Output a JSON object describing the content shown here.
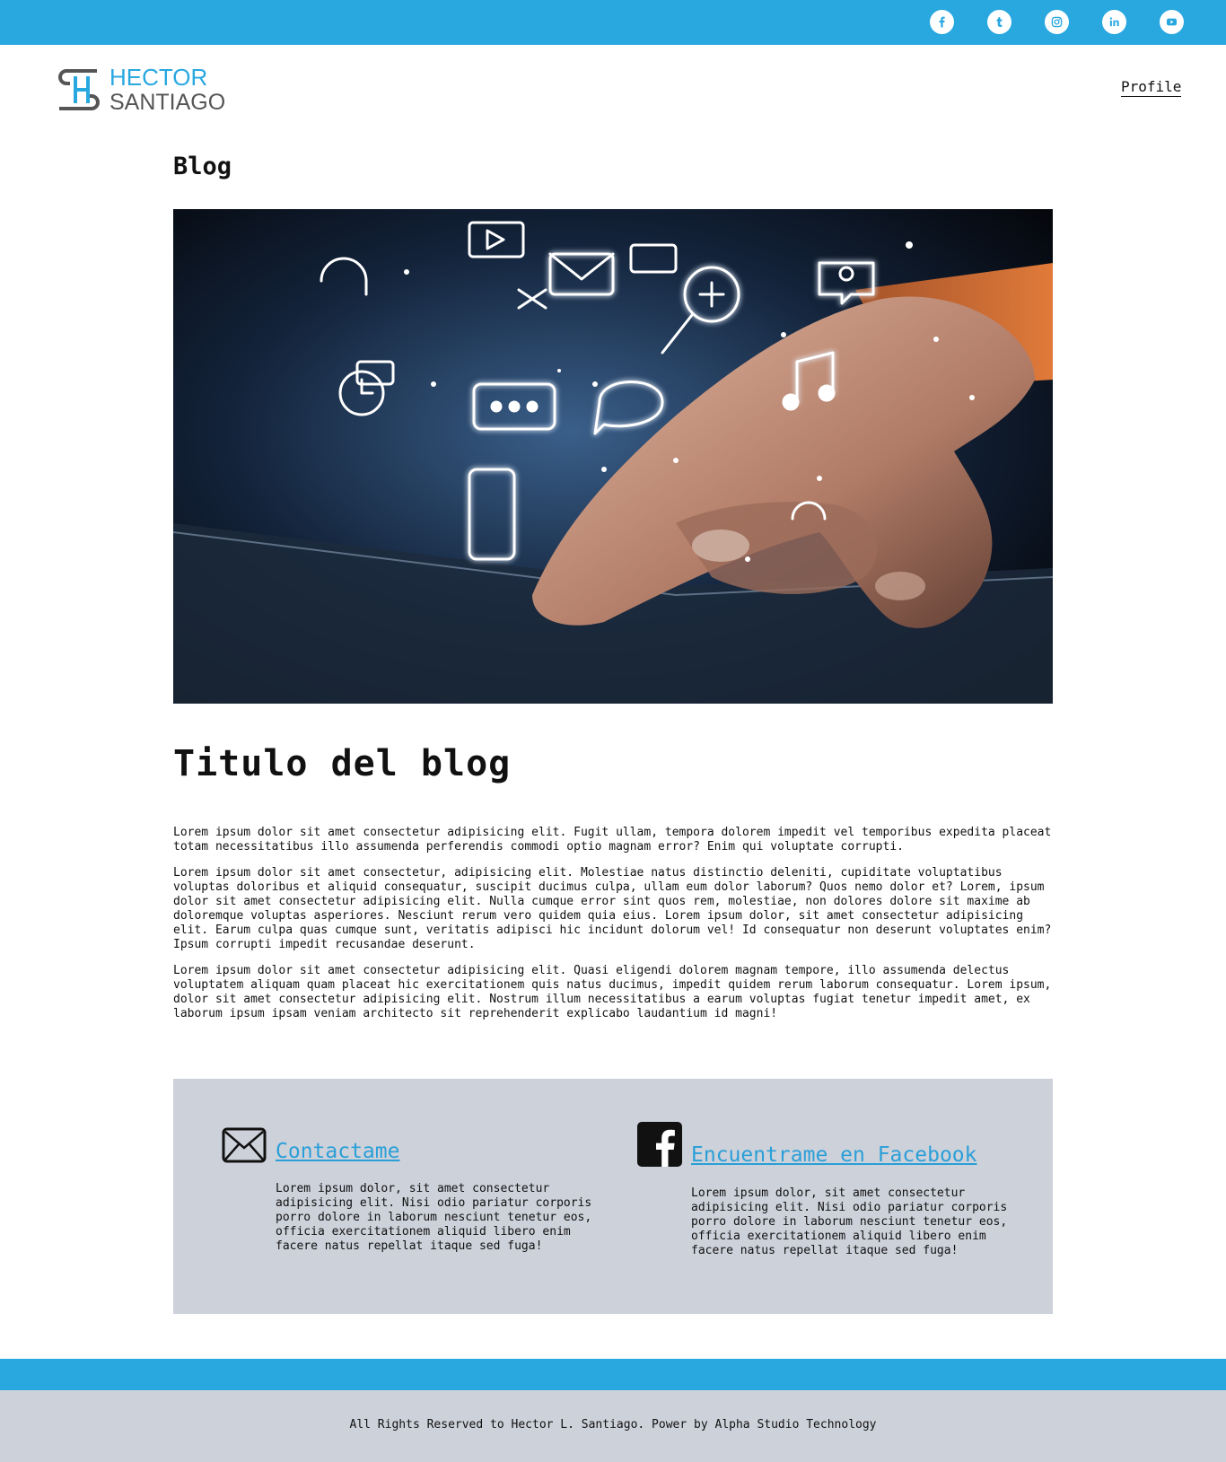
{
  "topbar": {
    "accent": "#29a8e0",
    "social": [
      {
        "icon": "facebook-icon"
      },
      {
        "icon": "tumblr-icon"
      },
      {
        "icon": "instagram-icon"
      },
      {
        "icon": "linkedin-icon"
      },
      {
        "icon": "youtube-icon"
      }
    ]
  },
  "header": {
    "logo_line1": "HECTOR",
    "logo_line2": "SANTIAGO",
    "nav_profile": "Profile"
  },
  "main": {
    "section_heading": "Blog",
    "hero_image": "hand-touching-tablet-with-glowing-app-icons",
    "post_title": "Titulo del blog",
    "paragraphs": [
      "Lorem ipsum dolor sit amet consectetur adipisicing elit. Fugit ullam, tempora dolorem impedit vel temporibus expedita placeat totam necessitatibus illo assumenda perferendis commodi optio magnam error? Enim qui voluptate corrupti.",
      "Lorem ipsum dolor sit amet consectetur, adipisicing elit. Molestiae natus distinctio deleniti, cupiditate voluptatibus voluptas doloribus et aliquid consequatur, suscipit ducimus culpa, ullam eum dolor laborum? Quos nemo dolor et? Lorem, ipsum dolor sit amet consectetur adipisicing elit. Nulla cumque error sint quos rem, molestiae, non dolores dolore sit maxime ab doloremque voluptas asperiores. Nesciunt rerum vero quidem quia eius. Lorem ipsum dolor, sit amet consectetur adipisicing elit. Earum culpa quas cumque sunt, veritatis adipisci hic incidunt dolorum vel! Id consequatur non deserunt voluptates enim? Ipsum corrupti impedit recusandae deserunt.",
      "Lorem ipsum dolor sit amet consectetur adipisicing elit. Quasi eligendi dolorem magnam tempore, illo assumenda delectus voluptatem aliquam quam placeat hic exercitationem quis natus ducimus, impedit quidem rerum laborum consequatur. Lorem ipsum, dolor sit amet consectetur adipisicing elit. Nostrum illum necessitatibus a earum voluptas fugiat tenetur impedit amet, ex laborum ipsum ipsam veniam architecto sit reprehenderit explicabo laudantium id magni!"
    ]
  },
  "contact": {
    "mail": {
      "icon": "envelope-icon",
      "link": "Contactame",
      "text": "Lorem ipsum dolor, sit amet consectetur adipisicing elit. Nisi odio pariatur corporis porro dolore in laborum nesciunt tenetur eos, officia exercitationem aliquid libero enim facere natus repellat itaque sed fuga!"
    },
    "facebook": {
      "icon": "facebook-square-icon",
      "link": "Encuentrame en Facebook",
      "text": "Lorem ipsum dolor, sit amet consectetur adipisicing elit. Nisi odio pariatur corporis porro dolore in laborum nesciunt tenetur eos, officia exercitationem aliquid libero enim facere natus repellat itaque sed fuga!"
    }
  },
  "footer": {
    "text": "All Rights Reserved to Hector L. Santiago. Power by Alpha Studio Technology"
  }
}
